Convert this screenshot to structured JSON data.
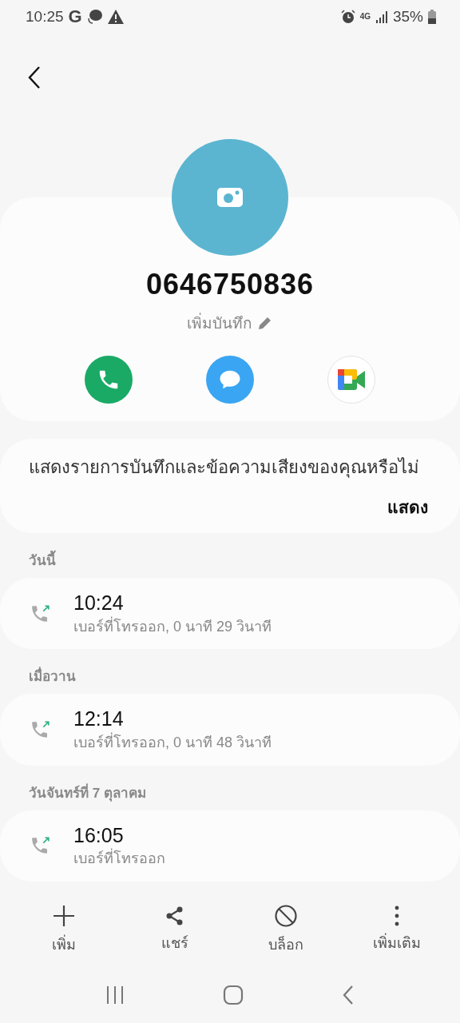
{
  "status_bar": {
    "time": "10:25",
    "g_label": "G",
    "network": "4G",
    "battery": "35%"
  },
  "contact": {
    "number": "0646750836",
    "note_link": "เพิ่มบันทึก"
  },
  "actions": [
    {
      "kind": "call"
    },
    {
      "kind": "message"
    },
    {
      "kind": "video"
    }
  ],
  "recordings_prompt": {
    "text": "แสดงรายการบันทึกและข้อความเสียงของคุณหรือไม่",
    "button": "แสดง"
  },
  "call_groups": [
    {
      "heading": "วันนี้",
      "calls": [
        {
          "kind": "outgoing",
          "time": "10:24",
          "detail": "เบอร์ที่โทรออก, 0 นาที 29 วินาที"
        }
      ]
    },
    {
      "heading": "เมื่อวาน",
      "calls": [
        {
          "kind": "outgoing",
          "time": "12:14",
          "detail": "เบอร์ที่โทรออก, 0 นาที 48 วินาที"
        }
      ]
    },
    {
      "heading": "วันจันทร์ที่ 7 ตุลาคม",
      "calls": [
        {
          "kind": "outgoing",
          "time": "16:05",
          "detail": "เบอร์ที่โทรออก"
        }
      ]
    }
  ],
  "bottom_actions": [
    {
      "kind": "add",
      "label": "เพิ่ม"
    },
    {
      "kind": "share",
      "label": "แชร์"
    },
    {
      "kind": "block",
      "label": "บล็อก"
    },
    {
      "kind": "more",
      "label": "เพิ่มเติม"
    }
  ]
}
